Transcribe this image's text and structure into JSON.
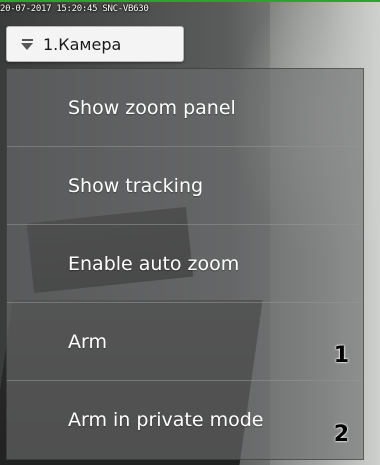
{
  "osd": {
    "text": "20-07-2017 15:20:45 SNC-VB630"
  },
  "camera_tab": {
    "label": "1.Камера",
    "icon": "chevron-down-icon"
  },
  "menu": {
    "items": [
      {
        "label": "Show zoom panel",
        "number": ""
      },
      {
        "label": "Show tracking",
        "number": ""
      },
      {
        "label": "Enable auto zoom",
        "number": ""
      },
      {
        "label": "Arm",
        "number": "1"
      },
      {
        "label": "Arm in private mode",
        "number": "2"
      }
    ]
  },
  "colors": {
    "menu_background": "#6c6c6e",
    "menu_text": "#ffffff",
    "tab_background": "#f4f4f4",
    "status_line": "#2ea42e"
  }
}
